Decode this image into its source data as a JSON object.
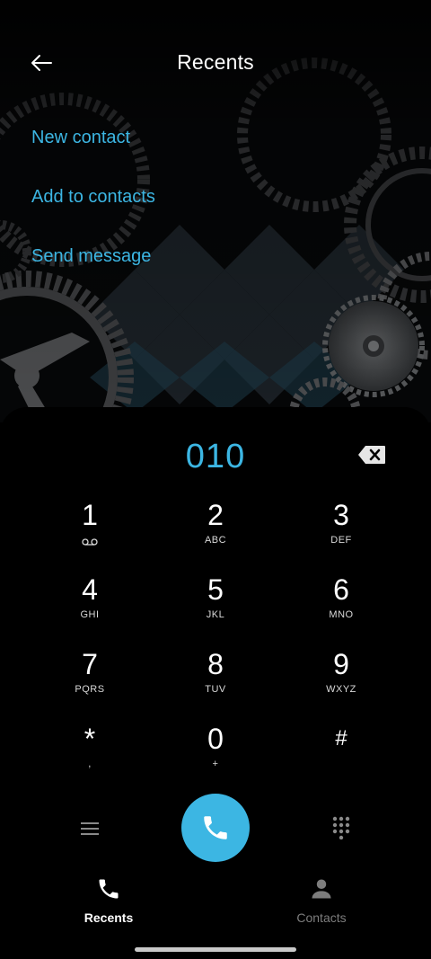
{
  "header": {
    "title": "Recents"
  },
  "actions": {
    "new_contact": "New contact",
    "add_to_contacts": "Add to contacts",
    "send_message": "Send message"
  },
  "dialer": {
    "number": "010",
    "keys": [
      {
        "digit": "1",
        "letters": ""
      },
      {
        "digit": "2",
        "letters": "ABC"
      },
      {
        "digit": "3",
        "letters": "DEF"
      },
      {
        "digit": "4",
        "letters": "GHI"
      },
      {
        "digit": "5",
        "letters": "JKL"
      },
      {
        "digit": "6",
        "letters": "MNO"
      },
      {
        "digit": "7",
        "letters": "PQRS"
      },
      {
        "digit": "8",
        "letters": "TUV"
      },
      {
        "digit": "9",
        "letters": "WXYZ"
      },
      {
        "digit": "*",
        "letters": ","
      },
      {
        "digit": "0",
        "letters": "+"
      },
      {
        "digit": "#",
        "letters": ""
      }
    ]
  },
  "nav": {
    "recents": "Recents",
    "contacts": "Contacts"
  },
  "colors": {
    "accent": "#3cb6e3",
    "inactive": "#7d7d7d"
  },
  "icons": {
    "back": "arrow-left-icon",
    "backspace": "backspace-icon",
    "voicemail": "voicemail-icon",
    "menu": "menu-icon",
    "call": "phone-icon",
    "dialpad": "dialpad-icon",
    "recents": "phone-icon",
    "contacts": "person-icon"
  }
}
